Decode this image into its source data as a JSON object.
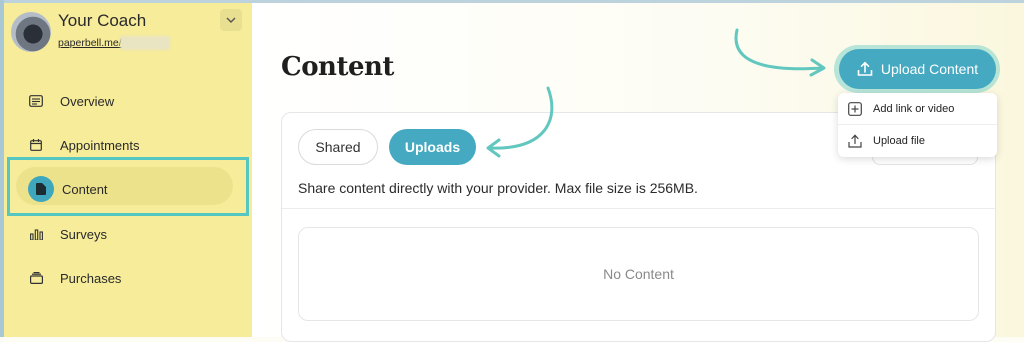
{
  "sidebar": {
    "coach_name": "Your Coach",
    "coach_link": "paperbell.me/",
    "items": [
      {
        "label": "Overview",
        "icon": "list-icon"
      },
      {
        "label": "Appointments",
        "icon": "calendar-icon"
      },
      {
        "label": "Content",
        "icon": "document-icon",
        "active": true
      },
      {
        "label": "Surveys",
        "icon": "bar-chart-icon"
      },
      {
        "label": "Purchases",
        "icon": "stack-icon"
      }
    ]
  },
  "main": {
    "title": "Content",
    "upload_button": "Upload Content",
    "upload_menu": [
      {
        "label": "Add link or video",
        "icon": "plus-square-icon"
      },
      {
        "label": "Upload file",
        "icon": "upload-icon"
      }
    ],
    "tabs": [
      {
        "label": "Shared",
        "active": false
      },
      {
        "label": "Uploads",
        "active": true
      }
    ],
    "description": "Share content directly with your provider. Max file size is 256MB.",
    "empty_state": "No Content"
  },
  "colors": {
    "accent": "#44a9c1",
    "highlight": "#55c6c0",
    "sidebar_bg": "#f6ec9a"
  }
}
